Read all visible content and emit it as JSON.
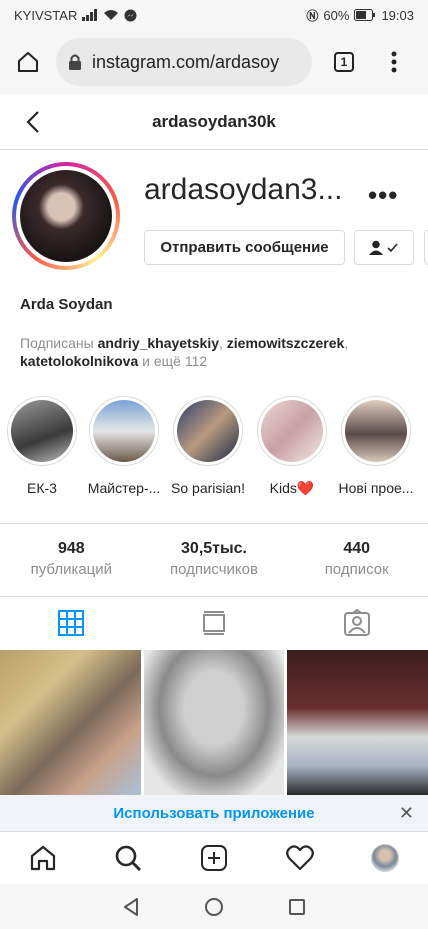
{
  "status_bar": {
    "carrier": "KYIVSTAR",
    "battery": "60%",
    "time": "19:03"
  },
  "browser": {
    "url": "instagram.com/ardasoy",
    "tab_count": "1"
  },
  "header": {
    "title": "ardasoydan30k"
  },
  "profile": {
    "username": "ardasoydan3...",
    "message_button": "Отправить сообщение",
    "full_name": "Arda Soydan",
    "followed_by_prefix": "Подписаны ",
    "followed_by_users": [
      "andriy_khayetskiy",
      "ziemowitszczerek",
      "katetolokolnikova"
    ],
    "followed_by_more": " и ещё 112"
  },
  "highlights": [
    {
      "label": "ЕК-3"
    },
    {
      "label": "Майстер-..."
    },
    {
      "label": "So parisian!"
    },
    {
      "label": "Kids❤️"
    },
    {
      "label": "Нові прое..."
    }
  ],
  "stats": [
    {
      "value": "948",
      "label": "публикаций"
    },
    {
      "value": "30,5тыс.",
      "label": "подписчиков"
    },
    {
      "value": "440",
      "label": "подписок"
    }
  ],
  "app_banner": {
    "cta": "Использовать приложение",
    "close": "✕"
  },
  "colors": {
    "accent": "#0095f6",
    "border": "#dbdbdb",
    "muted": "#8e8e8e"
  }
}
